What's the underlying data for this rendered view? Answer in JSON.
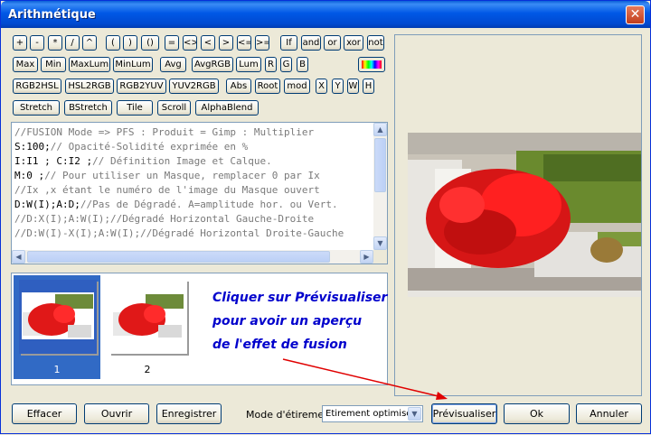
{
  "window": {
    "title": "Arithmétique",
    "close_glyph": "✕"
  },
  "toolbar": {
    "row1": [
      "+",
      "-",
      "*",
      "/",
      "^",
      "(",
      ")",
      "()",
      "=",
      "<>",
      "<",
      ">",
      "<=",
      ">=",
      "If",
      "and",
      "or",
      "xor",
      "not"
    ],
    "row2": [
      "Max",
      "Min",
      "MaxLum",
      "MinLum",
      "Avg",
      "AvgRGB",
      "Lum",
      "R",
      "G",
      "B"
    ],
    "row3": [
      "RGB2HSL",
      "HSL2RGB",
      "RGB2YUV",
      "YUV2RGB",
      "Abs",
      "Root",
      "mod",
      "X",
      "Y",
      "W",
      "H"
    ],
    "row4": [
      "Stretch",
      "BStretch",
      "Tile",
      "Scroll",
      "AlphaBlend"
    ],
    "color_button_icon": "color-gradient-icon"
  },
  "editor": {
    "lines": [
      {
        "key": "",
        "text": "//FUSION Mode => PFS : Produit = Gimp : Multiplier"
      },
      {
        "key": "S:100;",
        "text": "// Opacité-Solidité exprimée en %"
      },
      {
        "key": "I:I1 ; C:I2 ;",
        "text": "// Définition Image et Calque."
      },
      {
        "key": "M:0 ;",
        "text": "// Pour utiliser un Masque, remplacer 0 par Ix"
      },
      {
        "key": "",
        "text": "//Ix ,x étant le numéro de l'image du Masque ouvert"
      },
      {
        "key": "D:W(I);A:D;",
        "text": "//Pas de Dégradé. A=amplitude hor. ou Vert."
      },
      {
        "key": "",
        "text": "//D:X(I);A:W(I);//Dégradé Horizontal Gauche-Droite"
      },
      {
        "key": "",
        "text": "//D:W(I)-X(I);A:W(I);//Dégradé Horizontal Droite-Gauche"
      }
    ]
  },
  "thumbnails": [
    {
      "label": "1",
      "selected": true
    },
    {
      "label": "2",
      "selected": false
    }
  ],
  "hint": {
    "line1": "Cliquer sur Prévisualiser",
    "line2": "pour avoir un aperçu",
    "line3": "de l'effet de fusion"
  },
  "bottom": {
    "effacer": "Effacer",
    "ouvrir": "Ouvrir",
    "enregistrer": "Enregistrer",
    "mode_label": "Mode d'étirement",
    "mode_value": "Etirement optimisé",
    "previsualiser": "Prévisualiser",
    "ok": "Ok",
    "annuler": "Annuler"
  },
  "colors": {
    "title_bar": "#0058e6",
    "hint_text": "#0000cc",
    "arrow": "#e00000",
    "selection": "#316ac5"
  }
}
